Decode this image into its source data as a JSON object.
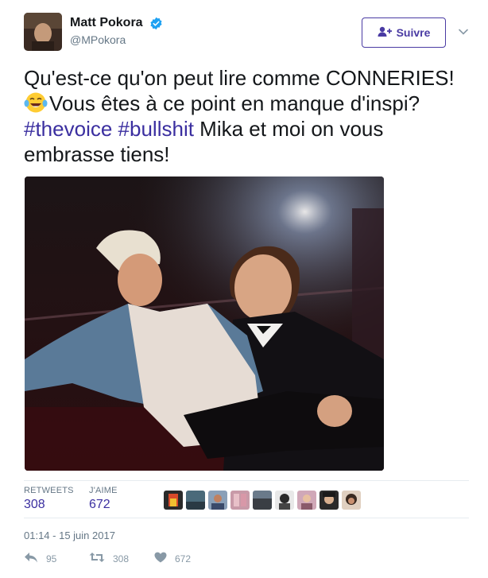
{
  "user": {
    "display_name": "Matt Pokora",
    "handle": "@MPokora",
    "verified_icon": "verified-badge-icon"
  },
  "follow_button": {
    "label": "Suivre",
    "icon": "follow-user-icon"
  },
  "tweet": {
    "text_part1": "Qu'est-ce qu'on peut lire comme CONNERIES! ",
    "emoji": "tears-of-joy-emoji",
    "text_part2": "Vous êtes à ce point en manque d'inspi? ",
    "hashtag1": "#thevoice",
    "hashtag2": "#bullshit",
    "text_part3": " Mika et moi on vous embrasse tiens!"
  },
  "stats": {
    "retweets_label": "RETWEETS",
    "retweets_value": "308",
    "likes_label": "J'AIME",
    "likes_value": "672"
  },
  "timestamp": "01:14 - 15 juin 2017",
  "actions": {
    "reply_count": "95",
    "retweet_count": "308",
    "like_count": "672"
  },
  "colors": {
    "accent": "#3b2fa0",
    "muted": "#657786",
    "icon_gray": "#8899a6"
  }
}
